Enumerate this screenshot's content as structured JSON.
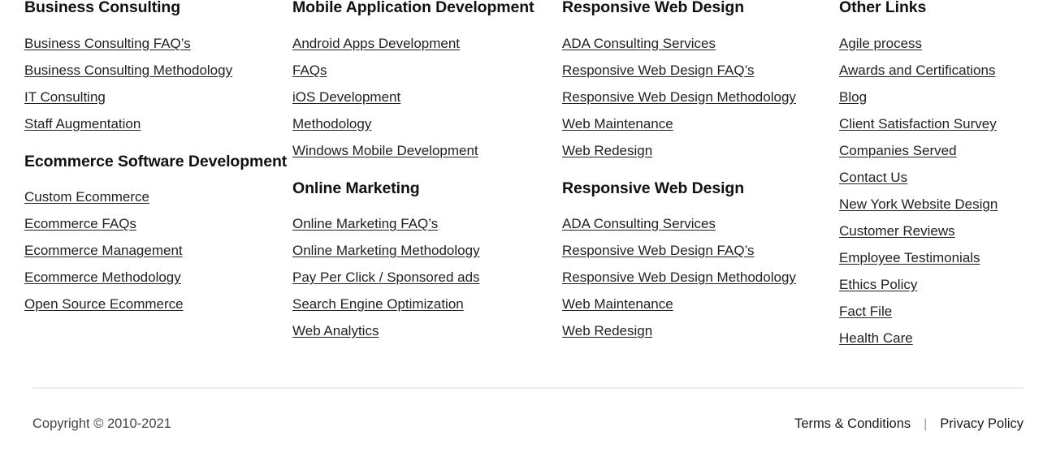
{
  "footer": {
    "columns": [
      {
        "name": "column-1",
        "sections": [
          {
            "heading": "Business Consulting",
            "links": [
              "Business Consulting FAQ’s",
              "Business Consulting Methodology",
              "IT Consulting",
              "Staff Augmentation"
            ]
          },
          {
            "heading": "Ecommerce Software Development",
            "links": [
              "Custom Ecommerce",
              "Ecommerce FAQs",
              "Ecommerce Management",
              "Ecommerce Methodology",
              "Open Source Ecommerce"
            ]
          }
        ]
      },
      {
        "name": "column-2",
        "sections": [
          {
            "heading": "Mobile Application Development",
            "links": [
              "Android Apps Development",
              "FAQs",
              "iOS Development",
              "Methodology",
              "Windows Mobile Development"
            ]
          },
          {
            "heading": "Online Marketing",
            "links": [
              "Online Marketing FAQ’s",
              "Online Marketing Methodology",
              "Pay Per Click / Sponsored ads",
              "Search Engine Optimization",
              "Web Analytics"
            ]
          }
        ]
      },
      {
        "name": "column-3",
        "sections": [
          {
            "heading": "Responsive Web Design",
            "links": [
              "ADA Consulting Services",
              "Responsive Web Design FAQ’s",
              "Responsive Web Design Methodology",
              "Web Maintenance",
              "Web Redesign"
            ]
          },
          {
            "heading": "Responsive Web Design",
            "links": [
              "ADA Consulting Services",
              "Responsive Web Design FAQ’s",
              "Responsive Web Design Methodology",
              "Web Maintenance",
              "Web Redesign"
            ]
          }
        ]
      },
      {
        "name": "column-4",
        "sections": [
          {
            "heading": "Other Links",
            "links": [
              "Agile process",
              "Awards and Certifications",
              "Blog",
              "Client Satisfaction Survey",
              "Companies Served",
              "Contact Us",
              "New York Website Design",
              "Customer Reviews",
              "Employee Testimonials",
              "Ethics Policy",
              "Fact File",
              "Health Care"
            ]
          }
        ]
      }
    ],
    "bottom": {
      "copyright": "Copyright © 2010-2021",
      "terms_label": "Terms & Conditions",
      "separator": "|",
      "privacy_label": "Privacy Policy"
    },
    "colors": {
      "background": "#ffffff",
      "heading_text": "#111111",
      "link_text": "#222222",
      "copyright_text": "#444444",
      "divider": "#ededed",
      "separator": "#999999"
    }
  }
}
